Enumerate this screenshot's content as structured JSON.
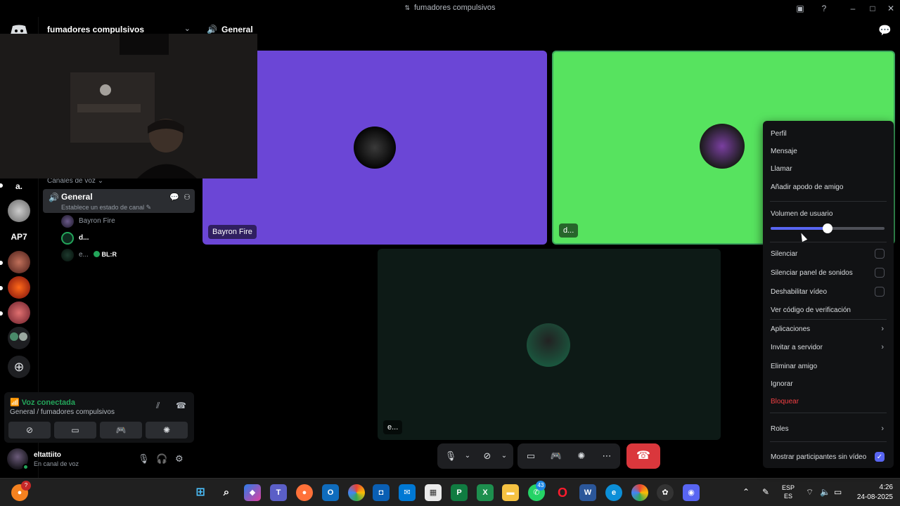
{
  "window": {
    "title": "fumadores compulsivos"
  },
  "server": {
    "name": "fumadores compulsivos"
  },
  "rail": {
    "items": [
      "a.",
      "AP7"
    ]
  },
  "sidebar": {
    "category": "Canales de voz",
    "channel": {
      "name": "General",
      "status": "Establece un estado de canal"
    },
    "members": [
      {
        "name": "Bayron Fire",
        "color": "#949ba4"
      },
      {
        "name": "d...",
        "color": "#ffffff"
      },
      {
        "name": "e...",
        "color": "#949ba4",
        "badge": "BL:R"
      }
    ]
  },
  "voice": {
    "title": "Voz conectada",
    "subtitle": "General / fumadores compulsivos"
  },
  "user": {
    "name": "eltattiito",
    "status": "En canal de voz"
  },
  "main": {
    "channel": "General"
  },
  "tiles": [
    {
      "name": "Bayron Fire",
      "color": "#6b46d6"
    },
    {
      "name": "d...",
      "color": "#57e35f"
    },
    {
      "name": "e...",
      "color": "#0d1a16"
    }
  ],
  "menu": {
    "items_top": [
      "Perfil",
      "Mensaje",
      "Llamar",
      "Añadir apodo de amigo"
    ],
    "volume_label": "Volumen de usuario",
    "volume_fraction": 0.5,
    "checkbox_items": [
      "Silenciar",
      "Silenciar panel de sonidos",
      "Deshabilitar vídeo"
    ],
    "verify": "Ver código de verificación",
    "submenu_items": [
      "Aplicaciones",
      "Invitar a servidor"
    ],
    "remove_friend": "Eliminar amigo",
    "ignore": "Ignorar",
    "block": "Bloquear",
    "roles": "Roles",
    "show_non_video": "Mostrar participantes sin vídeo"
  },
  "taskbar": {
    "lang_line1": "ESP",
    "lang_line2": "ES",
    "time": "4:26",
    "date": "24-08-2025",
    "whatsapp_badge": "43"
  },
  "colors": {
    "accent": "#5865f2",
    "online": "#23a55a",
    "danger": "#f23f43"
  }
}
